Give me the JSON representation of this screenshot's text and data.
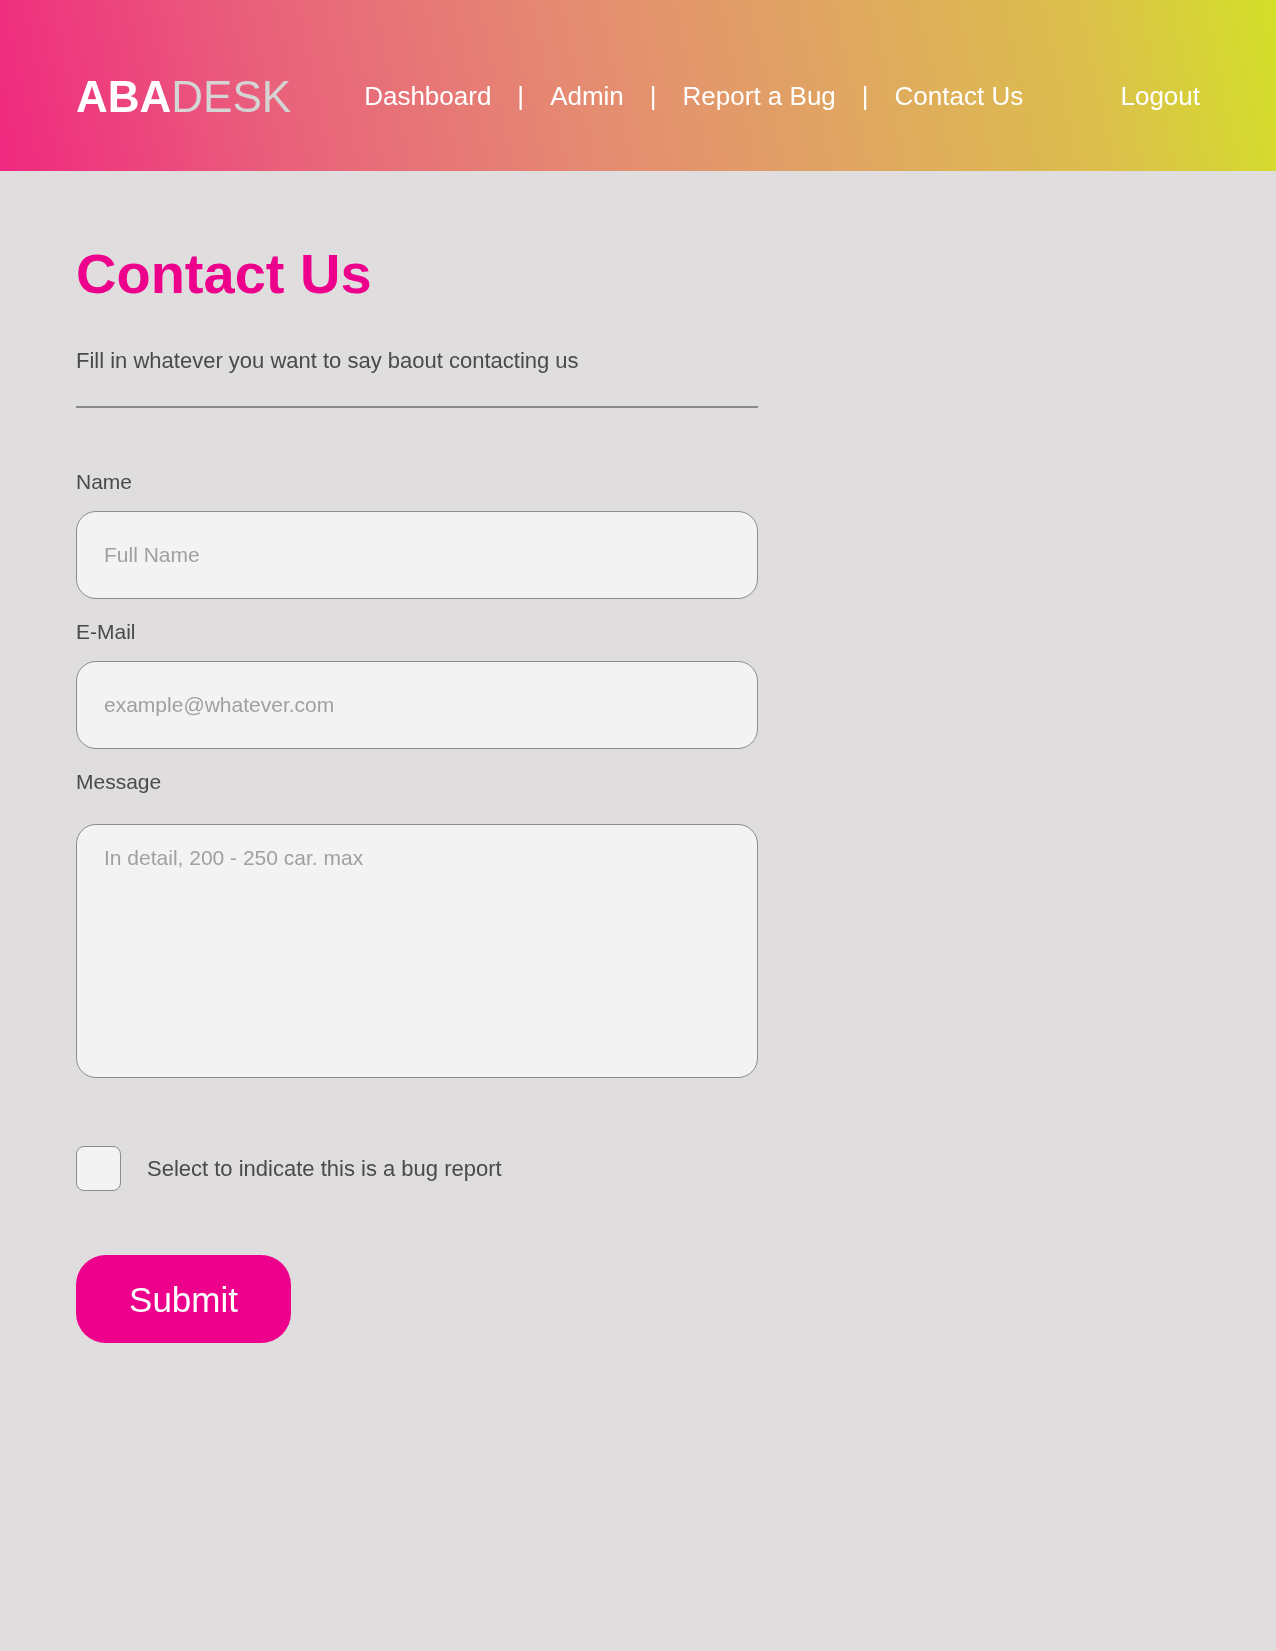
{
  "header": {
    "logo": {
      "bold_part": "ABA",
      "light_part": "DESK"
    },
    "nav": [
      {
        "label": "Dashboard",
        "separator_after": "|"
      },
      {
        "label": "Admin",
        "separator_after": "|"
      },
      {
        "label": "Report a Bug",
        "separator_after": "|"
      },
      {
        "label": "Contact Us"
      }
    ],
    "logout": "Logout"
  },
  "page": {
    "title": "Contact Us",
    "intro": "Fill in whatever you want to say baout contacting us"
  },
  "form": {
    "fields": [
      {
        "kind": "input",
        "label": "Name",
        "placeholder": "Full Name"
      },
      {
        "kind": "input",
        "label": "E-Mail",
        "placeholder": "example@whatever.com"
      },
      {
        "kind": "textarea",
        "label": "Message",
        "placeholder": "In detail, 200 - 250 car. max"
      }
    ],
    "checkbox": {
      "label": "Select to indicate this is a bug report",
      "checked": false
    },
    "submit": "Submit"
  }
}
